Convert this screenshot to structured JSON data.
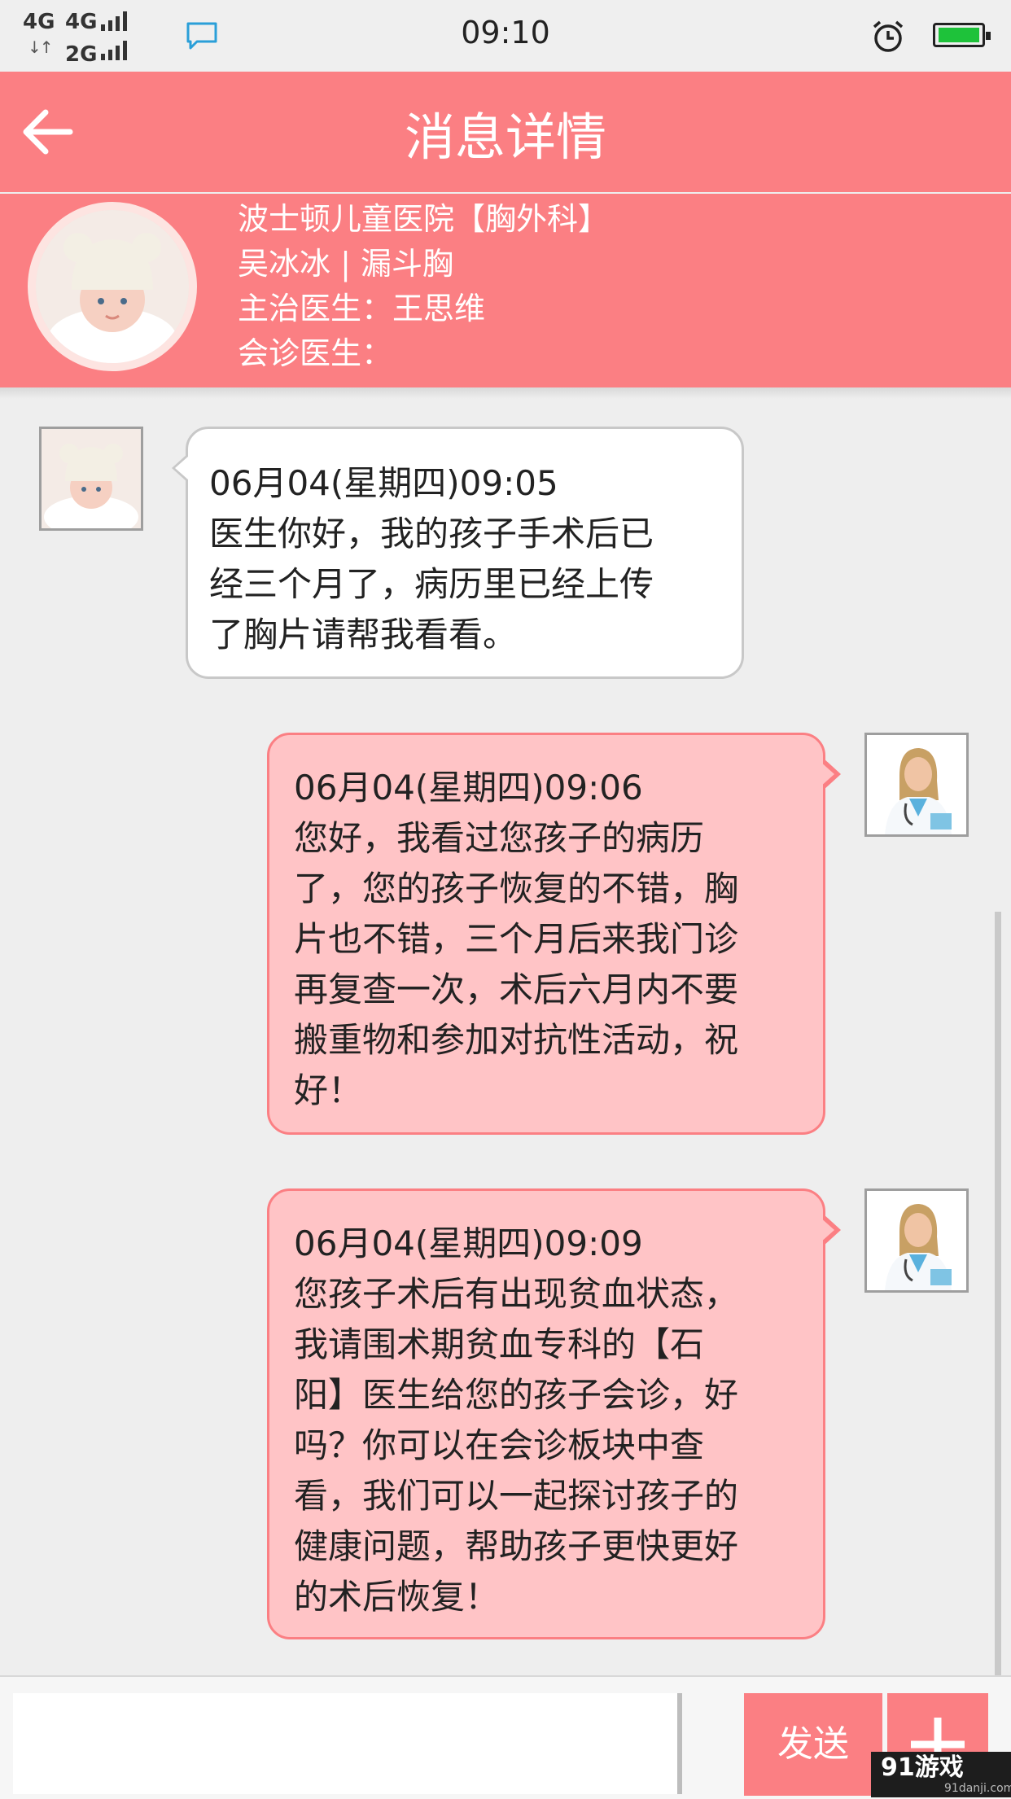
{
  "status_bar": {
    "network_top_left": "4G",
    "network_top_right": "4G",
    "network_bottom": "2G",
    "time": "09:10",
    "battery_level": 1.0,
    "accent_color": "#1ec23a"
  },
  "nav": {
    "title": "消息详情",
    "back_icon": "arrow-left-icon"
  },
  "patient": {
    "hospital": "波士顿儿童医院【胸外科】",
    "name_condition": "吴冰冰 | 漏斗胸",
    "attending": "主治医生：王思维",
    "consulting": "会诊医生："
  },
  "messages": [
    {
      "from": "patient",
      "time": "06月04(星期四)09:05",
      "lines": [
        "医生你好，我的孩子手术后已",
        "经三个月了，病历里已经上传",
        "了胸片请帮我看看。"
      ]
    },
    {
      "from": "doctor",
      "time": "06月04(星期四)09:06",
      "lines": [
        "您好，我看过您孩子的病历",
        "了，您的孩子恢复的不错，胸",
        "片也不错，三个月后来我门诊",
        "再复查一次，术后六月内不要",
        "搬重物和参加对抗性活动，祝",
        "好！"
      ]
    },
    {
      "from": "doctor",
      "time": "06月04(星期四)09:09",
      "lines": [
        "您孩子术后有出现贫血状态，",
        "我请围术期贫血专科的【石",
        "阳】医生给您的孩子会诊，好",
        "吗？你可以在会诊板块中查",
        "看，我们可以一起探讨孩子的",
        "健康问题，帮助孩子更快更好",
        "的术后恢复！"
      ]
    }
  ],
  "composer": {
    "placeholder": "",
    "send_label": "发送",
    "plus_icon": "plus-icon"
  },
  "watermark": {
    "brand": "91游戏",
    "domain": "91danji.com"
  },
  "colors": {
    "brand_pink": "#fb7f83",
    "doctor_bubble": "#ffc4c6",
    "background": "#eeeeee"
  }
}
